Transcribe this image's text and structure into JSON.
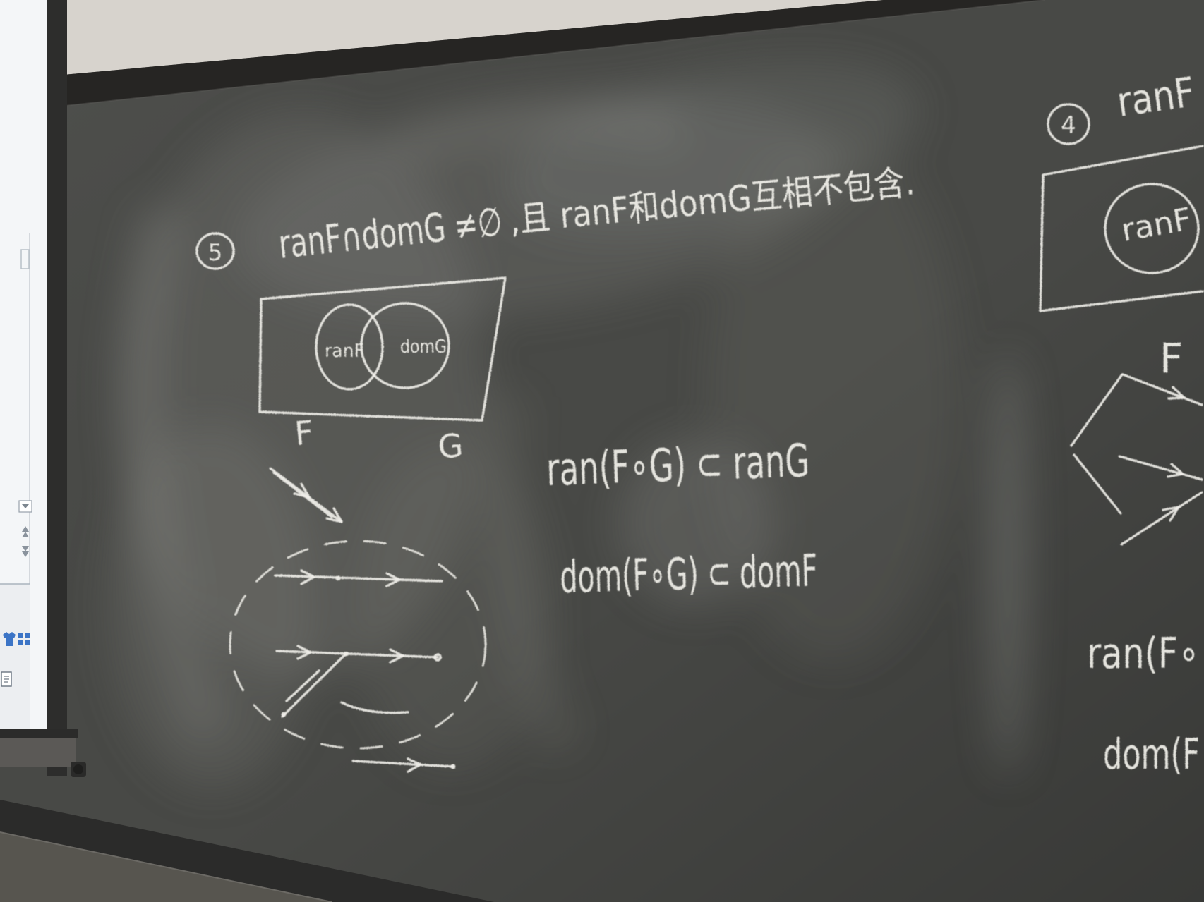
{
  "board": {
    "left_problem": {
      "number": "5",
      "condition": "ranF∩domG ≠∅",
      "condition_note": ",且 ranF和domG互相不包含.",
      "venn_left_circle": "ranF",
      "venn_right_circle": "domG",
      "relation_label_left": "F",
      "relation_label_right": "G",
      "range_result": "ran(F∘G) ⊂ ranG",
      "domain_result": "dom(F∘G) ⊂ domF"
    },
    "right_problem": {
      "number": "4",
      "condition": "ranF",
      "venn_circle": "ranF",
      "relation_label": "F",
      "range_result": "ran(F∘",
      "domain_result": "dom(F"
    }
  },
  "projector_screen": {
    "icons": [
      "dropdown-icon",
      "scroll-up-icon",
      "scroll-down-icon",
      "shirt-icon",
      "grid-icon",
      "document-icon"
    ]
  },
  "colors": {
    "board": "#484946",
    "chalk": "#f1f0ea",
    "wall": "#d7d3cd",
    "frame": "#262523",
    "screen": "#f4f6f8",
    "screen_icon": "#3c74c6"
  }
}
